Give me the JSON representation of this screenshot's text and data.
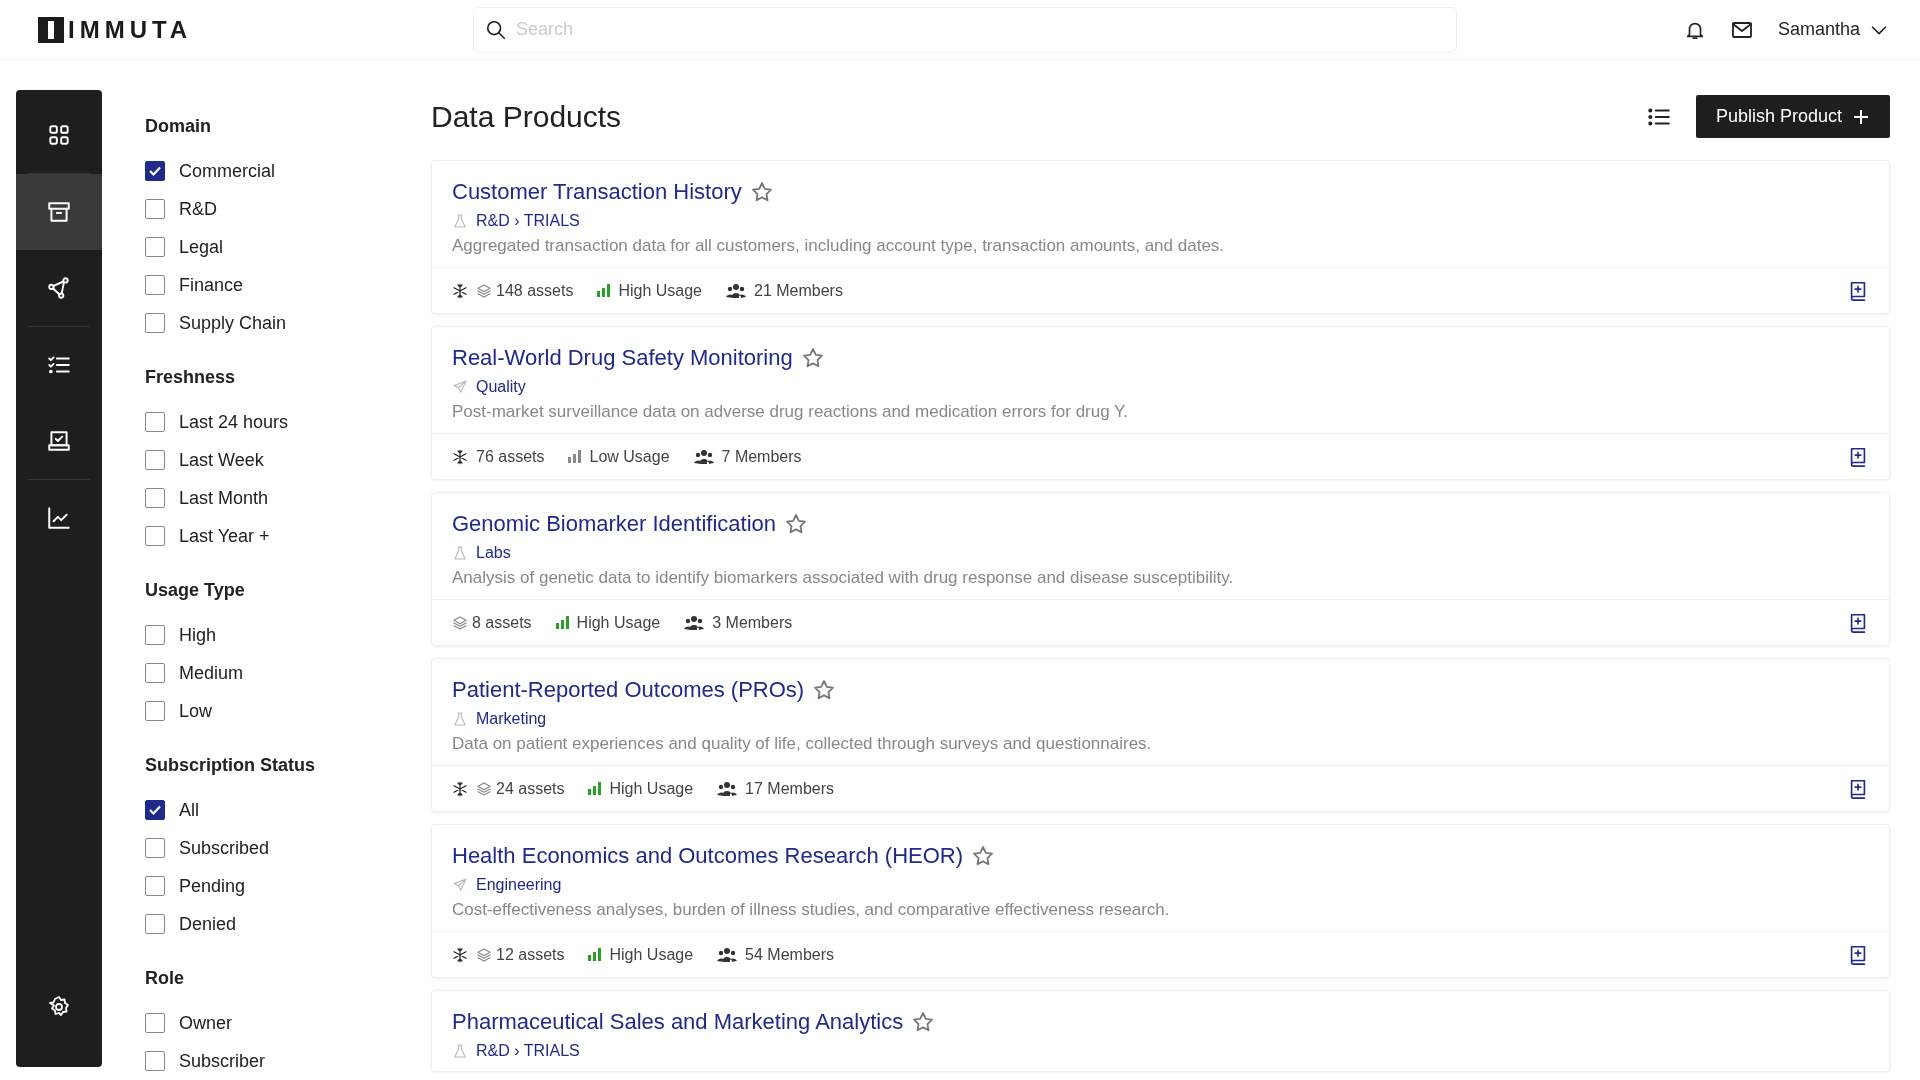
{
  "header": {
    "logo": "IMMUTA",
    "search": {
      "placeholder": "Search"
    },
    "user": "Samantha"
  },
  "nav": {
    "items": [
      {
        "selected": false
      },
      {
        "selected": true
      },
      {
        "selected": false
      },
      {
        "selected": false
      },
      {
        "selected": false
      },
      {
        "selected": false
      }
    ]
  },
  "filters": [
    {
      "title": "Domain",
      "options": [
        {
          "label": "Commercial",
          "checked": true
        },
        {
          "label": "R&D",
          "checked": false
        },
        {
          "label": "Legal",
          "checked": false
        },
        {
          "label": "Finance",
          "checked": false
        },
        {
          "label": "Supply Chain",
          "checked": false
        }
      ]
    },
    {
      "title": "Freshness",
      "options": [
        {
          "label": "Last 24 hours",
          "checked": false
        },
        {
          "label": "Last Week",
          "checked": false
        },
        {
          "label": "Last Month",
          "checked": false
        },
        {
          "label": "Last Year +",
          "checked": false
        }
      ]
    },
    {
      "title": "Usage Type",
      "options": [
        {
          "label": "High",
          "checked": false
        },
        {
          "label": "Medium",
          "checked": false
        },
        {
          "label": "Low",
          "checked": false
        }
      ]
    },
    {
      "title": "Subscription Status",
      "options": [
        {
          "label": "All",
          "checked": true
        },
        {
          "label": "Subscribed",
          "checked": false
        },
        {
          "label": "Pending",
          "checked": false
        },
        {
          "label": "Denied",
          "checked": false
        }
      ]
    },
    {
      "title": "Role",
      "options": [
        {
          "label": "Owner",
          "checked": false
        },
        {
          "label": "Subscriber",
          "checked": false
        }
      ]
    }
  ],
  "page_title": "Data Products",
  "publish_button": "Publish Product",
  "products": [
    {
      "title": "Customer Transaction History",
      "domain": {
        "kind": "flask",
        "label": "R&D › TRIALS"
      },
      "description": "Aggregated transaction data for all customers, including account type, transaction amounts, and dates.",
      "snowflake": true,
      "layers": true,
      "assets": "148 assets",
      "usage": {
        "kind": "high",
        "label": "High Usage"
      },
      "members": "21 Members"
    },
    {
      "title": "Real-World Drug Safety Monitoring",
      "domain": {
        "kind": "plane",
        "label": "Quality"
      },
      "description": "Post-market surveillance data on adverse drug reactions and medication errors for drug Y.",
      "snowflake": true,
      "layers": false,
      "assets": "76 assets",
      "usage": {
        "kind": "low",
        "label": "Low Usage"
      },
      "members": "7 Members"
    },
    {
      "title": "Genomic Biomarker Identification",
      "domain": {
        "kind": "flask",
        "label": "Labs"
      },
      "description": "Analysis of genetic data to identify biomarkers associated with drug response and disease susceptibility.",
      "snowflake": false,
      "layers": true,
      "assets": "8 assets",
      "usage": {
        "kind": "high",
        "label": "High Usage"
      },
      "members": "3 Members"
    },
    {
      "title": "Patient-Reported Outcomes (PROs)",
      "domain": {
        "kind": "flask",
        "label": "Marketing"
      },
      "description": "Data on patient experiences and quality of life, collected through surveys and questionnaires.",
      "snowflake": true,
      "layers": true,
      "assets": "24 assets",
      "usage": {
        "kind": "high",
        "label": "High Usage"
      },
      "members": "17 Members"
    },
    {
      "title": "Health Economics and Outcomes Research (HEOR)",
      "domain": {
        "kind": "plane",
        "label": "Engineering"
      },
      "description": "Cost-effectiveness analyses, burden of illness studies, and comparative effectiveness research.",
      "snowflake": true,
      "layers": true,
      "assets": "12 assets",
      "usage": {
        "kind": "high",
        "label": "High Usage"
      },
      "members": "54 Members"
    },
    {
      "title": "Pharmaceutical Sales and Marketing Analytics",
      "domain": {
        "kind": "flask",
        "label": "R&D › TRIALS"
      }
    }
  ]
}
